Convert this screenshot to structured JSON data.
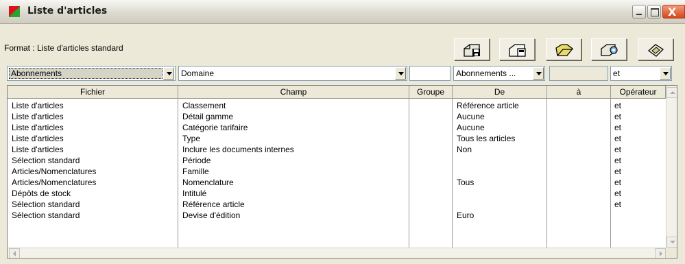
{
  "window": {
    "title": "Liste d'articles",
    "close_glyph": "X"
  },
  "toolbar": {
    "format_label": "Format : Liste d'articles standard",
    "buttons": [
      {
        "icon": "save-icon"
      },
      {
        "icon": "save-as-icon"
      },
      {
        "icon": "open-folder-icon"
      },
      {
        "icon": "print-icon"
      },
      {
        "icon": "eraser-icon"
      }
    ]
  },
  "filter": {
    "fichier": "Abonnements",
    "champ": "Domaine",
    "groupe": "",
    "de": "Abonnements ...",
    "a": "",
    "operateur": "et"
  },
  "grid": {
    "columns": [
      "Fichier",
      "Champ",
      "Groupe",
      "De",
      "à",
      "Opérateur"
    ],
    "rows": [
      {
        "fichier": "Liste d'articles",
        "champ": "Classement",
        "groupe": "",
        "de": "Référence article",
        "a": "",
        "operateur": "et"
      },
      {
        "fichier": "Liste d'articles",
        "champ": "Détail gamme",
        "groupe": "",
        "de": "Aucune",
        "a": "",
        "operateur": "et"
      },
      {
        "fichier": "Liste d'articles",
        "champ": "Catégorie tarifaire",
        "groupe": "",
        "de": "Aucune",
        "a": "",
        "operateur": "et"
      },
      {
        "fichier": "Liste d'articles",
        "champ": "Type",
        "groupe": "",
        "de": "Tous les articles",
        "a": "",
        "operateur": "et"
      },
      {
        "fichier": "Liste d'articles",
        "champ": "Inclure les documents internes",
        "groupe": "",
        "de": "Non",
        "a": "",
        "operateur": "et"
      },
      {
        "fichier": "Sélection standard",
        "champ": "Période",
        "groupe": "",
        "de": "",
        "a": "",
        "operateur": "et"
      },
      {
        "fichier": "Articles/Nomenclatures",
        "champ": "Famille",
        "groupe": "",
        "de": "",
        "a": "",
        "operateur": "et"
      },
      {
        "fichier": "Articles/Nomenclatures",
        "champ": "Nomenclature",
        "groupe": "",
        "de": "Tous",
        "a": "",
        "operateur": "et"
      },
      {
        "fichier": "Dépôts de stock",
        "champ": "Intitulé",
        "groupe": "",
        "de": "",
        "a": "",
        "operateur": "et"
      },
      {
        "fichier": "Sélection standard",
        "champ": "Référence article",
        "groupe": "",
        "de": "",
        "a": "",
        "operateur": "et"
      },
      {
        "fichier": "Sélection standard",
        "champ": "Devise d'édition",
        "groupe": "",
        "de": "Euro",
        "a": "",
        "operateur": ""
      }
    ]
  }
}
